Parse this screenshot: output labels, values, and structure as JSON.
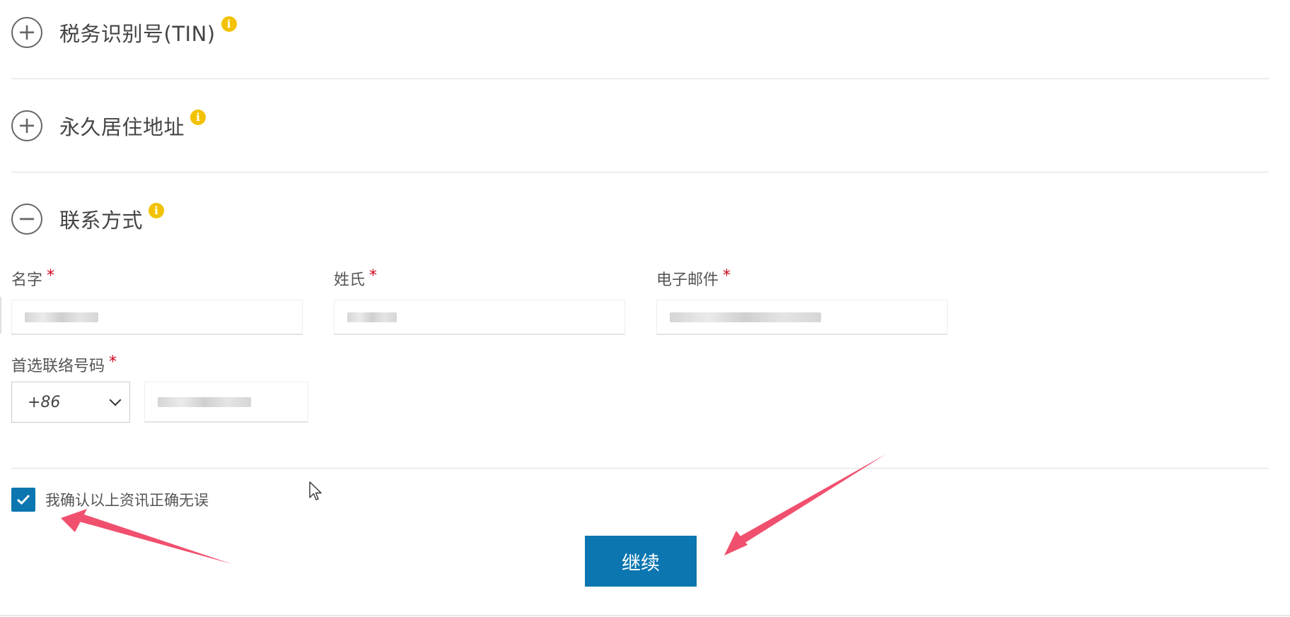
{
  "sections": [
    {
      "title": "税务识别号(TIN)",
      "toggle": "+"
    },
    {
      "title": "永久居住地址",
      "toggle": "+"
    },
    {
      "title": "联系方式",
      "toggle": "−"
    }
  ],
  "info_icon_glyph": "i",
  "contact": {
    "first_name_label": "名字",
    "last_name_label": "姓氏",
    "email_label": "电子邮件",
    "phone_label": "首选联络号码",
    "required_mark": "*",
    "country_code": "+86"
  },
  "confirm_label": "我确认以上资讯正确无误",
  "continue_label": "继续",
  "colors": {
    "primary": "#0b76b0",
    "required": "#d0021b",
    "info": "#f2c200",
    "annotation_arrow": "#f0506e"
  },
  "icons": {
    "expand": "plus-circle-icon",
    "collapse": "minus-circle-icon",
    "info": "info-icon",
    "check": "checkmark-icon",
    "dropdown": "chevron-down-icon"
  }
}
